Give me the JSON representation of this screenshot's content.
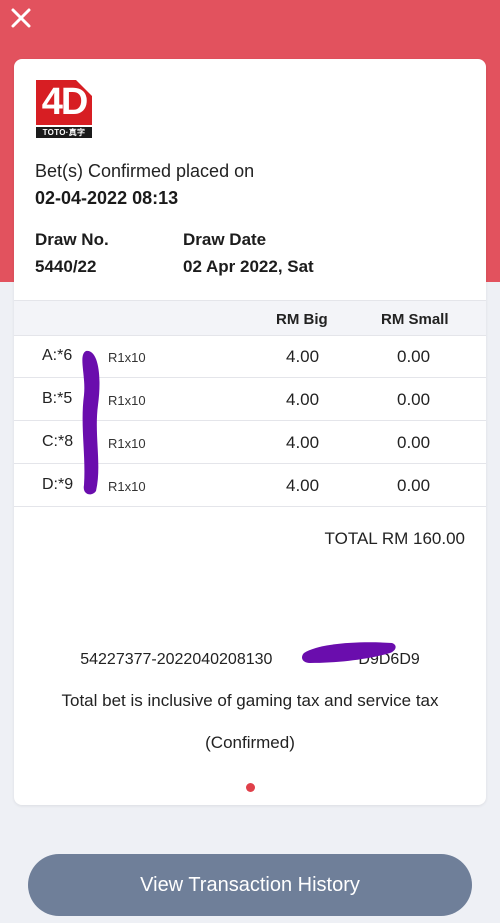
{
  "header": {
    "close_icon": "close-icon",
    "background_color": "#e2525e"
  },
  "logo": {
    "text": "4D",
    "brand": "TOTO·真字",
    "color": "#d71e23"
  },
  "bet": {
    "placed_label": "Bet(s) Confirmed placed on",
    "placed_value": "02-04-2022 08:13"
  },
  "draw": {
    "number_label": "Draw No.",
    "number_value": "5440/22",
    "date_label": "Draw Date",
    "date_value": "02 Apr 2022, Sat"
  },
  "table": {
    "headers": {
      "big": "RM Big",
      "small": "RM Small"
    },
    "rows": [
      {
        "number": "A:*6",
        "type": "R1x10",
        "big": "4.00",
        "small": "0.00"
      },
      {
        "number": "B:*5",
        "type": "R1x10",
        "big": "4.00",
        "small": "0.00"
      },
      {
        "number": "C:*8",
        "type": "R1x10",
        "big": "4.00",
        "small": "0.00"
      },
      {
        "number": "D:*9",
        "type": "R1x10",
        "big": "4.00",
        "small": "0.00"
      }
    ]
  },
  "total": "TOTAL RM 160.00",
  "reference": "54227377-2022040208130",
  "reference_tail": "D9D6D9",
  "tax_note": "Total bet is inclusive of gaming tax and service tax",
  "status": "(Confirmed)",
  "footer": {
    "button_label": "View Transaction History",
    "button_color": "#6f7f99"
  },
  "redaction_color": "#6a0dad"
}
